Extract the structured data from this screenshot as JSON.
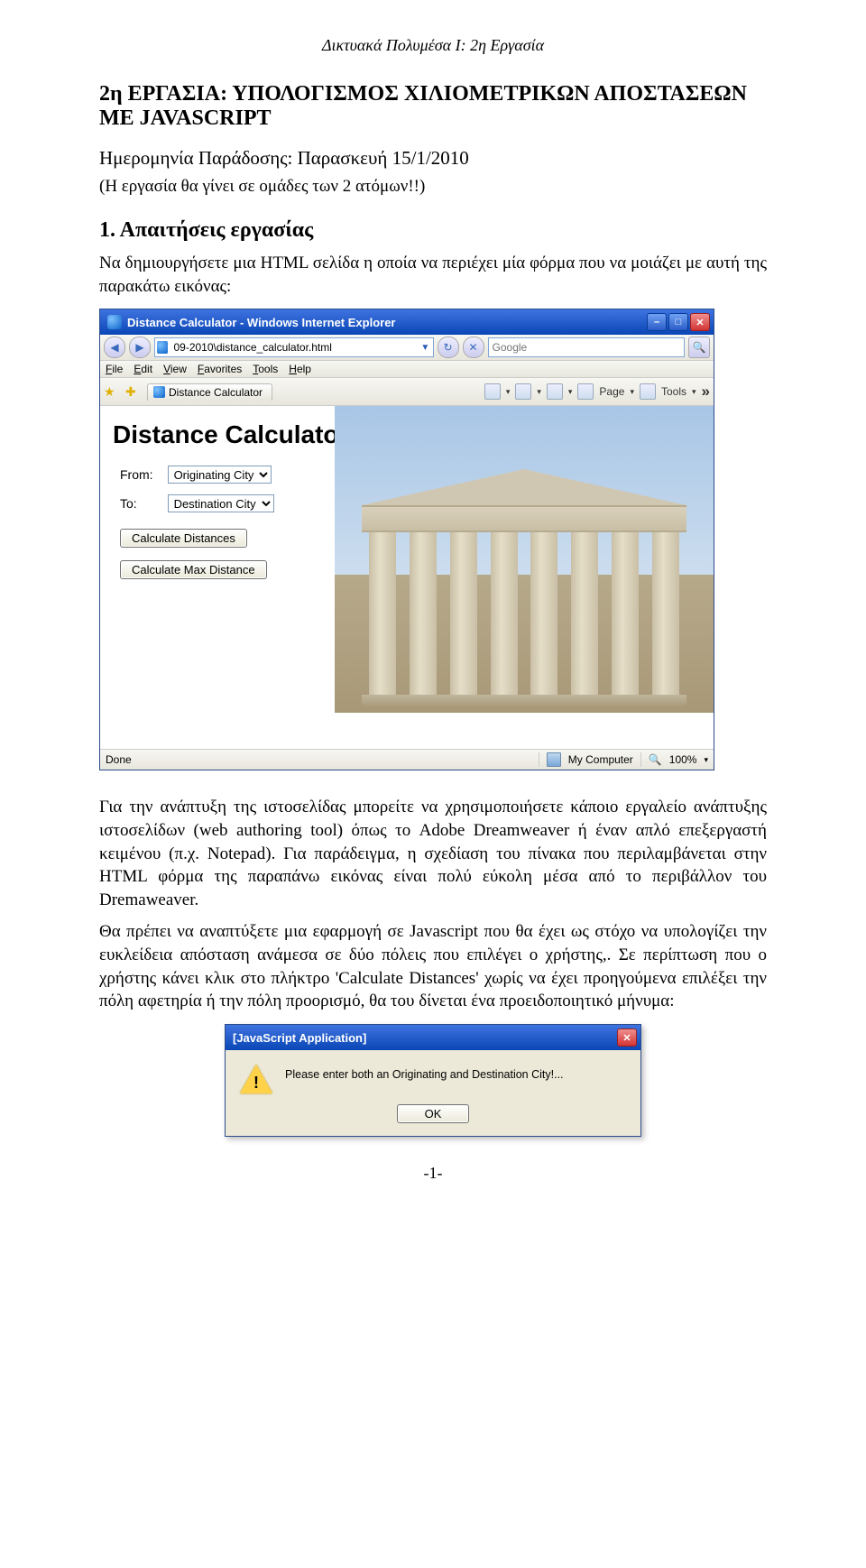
{
  "doc": {
    "header": "Δικτυακά Πολυμέσα I: 2η Εργασία",
    "title_sup": "η",
    "title": "2η ΕΡΓΑΣΙΑ: ΥΠΟΛΟΓΙΣΜΟΣ ΧΙΛΙΟΜΕΤΡΙΚΩΝ ΑΠΟΣΤΑΣΕΩΝ ΜΕ JAVASCRIPT",
    "due": "Ημερομηνία Παράδοσης: Παρασκευή 15/1/2010",
    "note": "(Η εργασία θα γίνει σε ομάδες των 2 ατόμων!!)",
    "section1": "1. Απαιτήσεις εργασίας",
    "para1": "Να δημιουργήσετε μια HTML σελίδα η οποία να περιέχει μία φόρμα που να μοιάζει με αυτή της παρακάτω εικόνας:",
    "para2": "Για την ανάπτυξη της ιστοσελίδας μπορείτε να χρησιμοποιήσετε κάποιο εργαλείο ανάπτυξης ιστοσελίδων (web authoring tool) όπως το Adobe Dreamweaver ή έναν απλό επεξεργαστή κειμένου (π.χ. Notepad). Για παράδειγμα, η σχεδίαση του πίνακα που περιλαμβάνεται στην HTML φόρμα της παραπάνω εικόνας είναι πολύ εύκολη μέσα από το περιβάλλον του Dremaweaver.",
    "para3": "Θα πρέπει να αναπτύξετε μια εφαρμογή σε Javascript που θα έχει ως στόχο να υπολογίζει την ευκλείδεια απόσταση ανάμεσα σε δύο πόλεις που επιλέγει ο χρήστης,. Σε περίπτωση που ο χρήστης κάνει κλικ στο πλήκτρο 'Calculate Distances' χωρίς να έχει προηγούμενα επιλέξει την πόλη αφετηρία ή την πόλη προορισμό, θα του δίνεται ένα προειδοποιητικό μήνυμα:",
    "page_number": "-1-"
  },
  "ie": {
    "window_title": "Distance Calculator - Windows Internet Explorer",
    "address": "09-2010\\distance_calculator.html",
    "search_placeholder": "Google",
    "menu": {
      "file": "File",
      "edit": "Edit",
      "view": "View",
      "favorites": "Favorites",
      "tools": "Tools",
      "help": "Help"
    },
    "tab_label": "Distance Calculator",
    "right_tools": {
      "page": "Page",
      "tools": "Tools"
    },
    "chevrons": "»",
    "content": {
      "heading": "Distance Calculator",
      "from_label": "From:",
      "to_label": "To:",
      "from_value": "Originating City",
      "to_value": "Destination City",
      "btn_calc": "Calculate Distances",
      "btn_max": "Calculate Max Distance"
    },
    "status": {
      "done": "Done",
      "zone": "My Computer",
      "zoom": "100%"
    }
  },
  "alert": {
    "title": "[JavaScript Application]",
    "message": "Please enter both an Originating and Destination City!...",
    "ok": "OK"
  }
}
